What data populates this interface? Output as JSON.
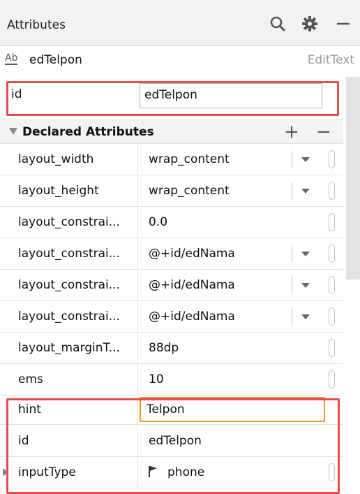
{
  "header": {
    "title": "Attributes",
    "search_icon": "search-icon",
    "settings_icon": "gear-icon",
    "minimize_icon": "minimize-icon"
  },
  "widget": {
    "icon_text": "Ab",
    "name": "edTelpon",
    "type": "EditText"
  },
  "id_field": {
    "label": "id",
    "value": "edTelpon"
  },
  "declared": {
    "title": "Declared Attributes",
    "add_label": "+",
    "remove_label": "−",
    "rows": [
      {
        "name": "layout_width",
        "value": "wrap_content"
      },
      {
        "name": "layout_height",
        "value": "wrap_content"
      },
      {
        "name": "layout_constrai...",
        "value": "0.0"
      },
      {
        "name": "layout_constrai...",
        "value": "@+id/edNama"
      },
      {
        "name": "layout_constrai...",
        "value": "@+id/edNama"
      },
      {
        "name": "layout_constrai...",
        "value": "@+id/edNama"
      },
      {
        "name": "layout_marginT...",
        "value": "88dp"
      },
      {
        "name": "ems",
        "value": "10"
      },
      {
        "name": "hint",
        "value": "Telpon"
      },
      {
        "name": "id",
        "value": "edTelpon"
      },
      {
        "name": "inputType",
        "value": "phone"
      }
    ]
  },
  "colors": {
    "highlight": "#e84a4f",
    "focus_border": "#e0a030"
  }
}
